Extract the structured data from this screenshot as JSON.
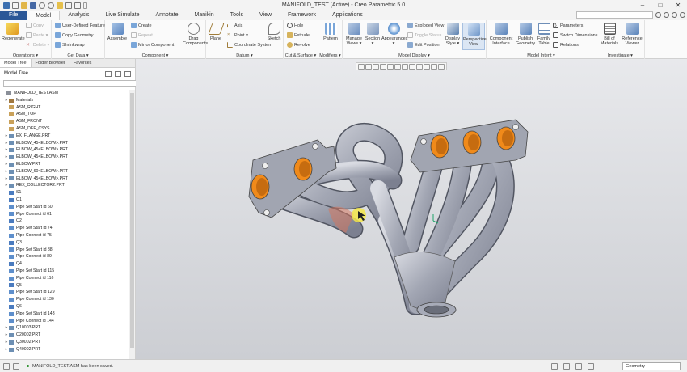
{
  "window": {
    "title": "MANIFOLD_TEST (Active) - Creo Parametric 5.0",
    "controls": [
      "–",
      "□",
      "✕"
    ]
  },
  "tabs": [
    "File",
    "Model",
    "Analysis",
    "Live Simulate",
    "Annotate",
    "Manikin",
    "Tools",
    "View",
    "Framework",
    "Applications"
  ],
  "active_tab": "Model",
  "ribbon": {
    "operations": {
      "label": "Operations ▾",
      "regenerate": "Regenerate",
      "copy": "Copy",
      "paste": "Paste ▾",
      "delete": "Delete ▾"
    },
    "get_data": {
      "label": "Get Data ▾",
      "udf": "User-Defined Feature",
      "copy_geometry": "Copy Geometry",
      "shrinkwrap": "Shrinkwrap"
    },
    "component": {
      "label": "Component ▾",
      "assemble": "Assemble",
      "create": "Create",
      "repeat": "Repeat",
      "mirror": "Mirror Component",
      "drag": "Drag Components"
    },
    "datum": {
      "label": "Datum ▾",
      "plane": "Plane",
      "axis": "Axis",
      "point": "Point ▾",
      "csys": "Coordinate System",
      "sketch": "Sketch"
    },
    "cut_surface": {
      "label": "Cut & Surface ▾",
      "hole": "Hole",
      "extrude": "Extrude",
      "revolve": "Revolve"
    },
    "modifiers": {
      "label": "Modifiers ▾",
      "pattern": "Pattern"
    },
    "model_display": {
      "label": "Model Display ▾",
      "manage_views": "Manage Views ▾",
      "section": "Section ▾",
      "appearances": "Appearances ▾",
      "exploded": "Exploded View",
      "toggle": "Toggle Status",
      "edit_position": "Edit Position",
      "display_style": "Display Style ▾",
      "perspective": "Perspective View"
    },
    "model_intent": {
      "label": "Model Intent ▾",
      "component_interface": "Component Interface",
      "publish": "Publish Geometry",
      "family": "Family Table",
      "parameters": "Parameters",
      "switch_dim": "Switch Dimensions",
      "relations": "Relations"
    },
    "investigate": {
      "label": "Investigate ▾",
      "bom": "Bill of Materials",
      "reference_viewer": "Reference Viewer"
    }
  },
  "panel": {
    "tabs": [
      "Model Tree",
      "Folder Browser",
      "Favorites"
    ],
    "header": "Model Tree",
    "search_placeholder": ""
  },
  "tree": [
    {
      "label": "MANIFOLD_TEST.ASM",
      "exp": "",
      "icon": "#8a8f98",
      "indent": 0
    },
    {
      "label": "Materials",
      "exp": "▸",
      "icon": "#a07840",
      "indent": 1
    },
    {
      "label": "ASM_RIGHT",
      "exp": "",
      "icon": "#c9a15a",
      "indent": 1
    },
    {
      "label": "ASM_TOP",
      "exp": "",
      "icon": "#c9a15a",
      "indent": 1
    },
    {
      "label": "ASM_FRONT",
      "exp": "",
      "icon": "#c9a15a",
      "indent": 1
    },
    {
      "label": "ASM_DEF_CSYS",
      "exp": "",
      "icon": "#c9a15a",
      "indent": 1
    },
    {
      "label": "EX_FLANGE.PRT",
      "exp": "▸",
      "icon": "#6d8fb3",
      "indent": 1
    },
    {
      "label": "ELBOW_45<ELBOW>.PRT",
      "exp": "▸",
      "icon": "#6d8fb3",
      "indent": 1
    },
    {
      "label": "ELBOW_45<ELBOW>.PRT",
      "exp": "▸",
      "icon": "#6d8fb3",
      "indent": 1
    },
    {
      "label": "ELBOW_45<ELBOW>.PRT",
      "exp": "▸",
      "icon": "#6d8fb3",
      "indent": 1
    },
    {
      "label": "ELBOW.PRT",
      "exp": "▸",
      "icon": "#6d8fb3",
      "indent": 1
    },
    {
      "label": "ELBOW_60<ELBOW>.PRT",
      "exp": "▸",
      "icon": "#6d8fb3",
      "indent": 1
    },
    {
      "label": "ELBOW_45<ELBOW>.PRT",
      "exp": "▸",
      "icon": "#6d8fb3",
      "indent": 1
    },
    {
      "label": "REX_COLLECTOR2.PRT",
      "exp": "▸",
      "icon": "#6d8fb3",
      "indent": 1
    },
    {
      "label": "S1",
      "exp": "",
      "icon": "#4a7bbf",
      "indent": 1
    },
    {
      "label": "Q1",
      "exp": "",
      "icon": "#4a7bbf",
      "indent": 1
    },
    {
      "label": "Pipe Set Start id 60",
      "exp": "",
      "icon": "#5e8fcc",
      "indent": 1
    },
    {
      "label": "Pipe Connect id 61",
      "exp": "",
      "icon": "#5e8fcc",
      "indent": 1
    },
    {
      "label": "Q2",
      "exp": "",
      "icon": "#4a7bbf",
      "indent": 1
    },
    {
      "label": "Pipe Set Start id 74",
      "exp": "",
      "icon": "#5e8fcc",
      "indent": 1
    },
    {
      "label": "Pipe Connect id 75",
      "exp": "",
      "icon": "#5e8fcc",
      "indent": 1
    },
    {
      "label": "Q3",
      "exp": "",
      "icon": "#4a7bbf",
      "indent": 1
    },
    {
      "label": "Pipe Set Start id 88",
      "exp": "",
      "icon": "#5e8fcc",
      "indent": 1
    },
    {
      "label": "Pipe Connect id 89",
      "exp": "",
      "icon": "#5e8fcc",
      "indent": 1
    },
    {
      "label": "Q4",
      "exp": "",
      "icon": "#4a7bbf",
      "indent": 1
    },
    {
      "label": "Pipe Set Start id 115",
      "exp": "",
      "icon": "#5e8fcc",
      "indent": 1
    },
    {
      "label": "Pipe Connect id 116",
      "exp": "",
      "icon": "#5e8fcc",
      "indent": 1
    },
    {
      "label": "Q5",
      "exp": "",
      "icon": "#4a7bbf",
      "indent": 1
    },
    {
      "label": "Pipe Set Start id 129",
      "exp": "",
      "icon": "#5e8fcc",
      "indent": 1
    },
    {
      "label": "Pipe Connect id 130",
      "exp": "",
      "icon": "#5e8fcc",
      "indent": 1
    },
    {
      "label": "Q6",
      "exp": "",
      "icon": "#4a7bbf",
      "indent": 1
    },
    {
      "label": "Pipe Set Start id 143",
      "exp": "",
      "icon": "#5e8fcc",
      "indent": 1
    },
    {
      "label": "Pipe Connect id 144",
      "exp": "",
      "icon": "#5e8fcc",
      "indent": 1
    },
    {
      "label": "Q10003.PRT",
      "exp": "▸",
      "icon": "#6d8fb3",
      "indent": 1
    },
    {
      "label": "Q20002.PRT",
      "exp": "▸",
      "icon": "#6d8fb3",
      "indent": 1
    },
    {
      "label": "Q30002.PRT",
      "exp": "▸",
      "icon": "#6d8fb3",
      "indent": 1
    },
    {
      "label": "Q40002.PRT",
      "exp": "▸",
      "icon": "#6d8fb3",
      "indent": 1
    }
  ],
  "status": {
    "message": "MANIFOLD_TEST.ASM has been saved.",
    "filter": "Geometry"
  },
  "colors": {
    "file_tab": "#2b5797",
    "orange": "#f08a1a",
    "highlight": "#f3e64a"
  }
}
